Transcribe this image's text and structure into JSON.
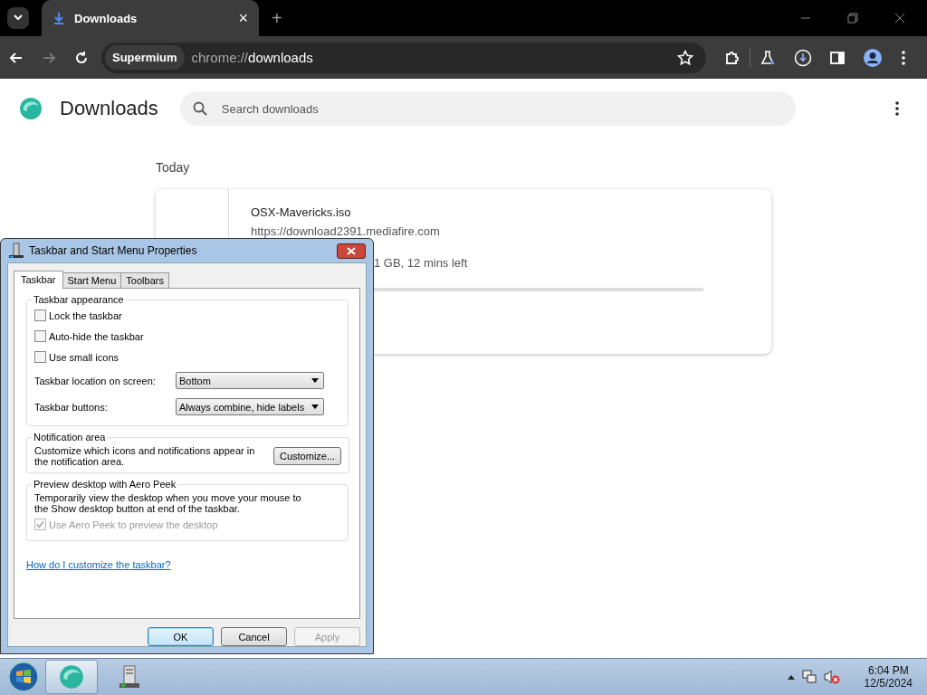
{
  "browser": {
    "tab": {
      "title": "Downloads",
      "close": "×"
    },
    "new_tab": "+",
    "address": {
      "chip": "Supermium",
      "scheme": "chrome://",
      "path": "downloads"
    }
  },
  "page": {
    "title": "Downloads",
    "search": {
      "placeholder": "Search downloads"
    },
    "section": "Today",
    "download": {
      "filename": "OSX-Mavericks.iso",
      "url": "https://download2391.mediafire.com",
      "status": "1 GB, 12 mins left"
    }
  },
  "dialog": {
    "title": "Taskbar and Start Menu Properties",
    "tabs": [
      {
        "label": "Taskbar",
        "selected": true
      },
      {
        "label": "Start Menu",
        "selected": false
      },
      {
        "label": "Toolbars",
        "selected": false
      }
    ],
    "appearance": {
      "legend": "Taskbar appearance",
      "options": [
        {
          "label": "Lock the taskbar",
          "checked": false,
          "disabled": false
        },
        {
          "label": "Auto-hide the taskbar",
          "checked": false,
          "disabled": false
        },
        {
          "label": "Use small icons",
          "checked": false,
          "disabled": false
        }
      ],
      "selects": [
        {
          "label": "Taskbar location on screen:",
          "value": "Bottom"
        },
        {
          "label": "Taskbar buttons:",
          "value": "Always combine, hide labels"
        }
      ]
    },
    "notification": {
      "legend": "Notification area",
      "text": "Customize which icons and notifications appear in the notification area.",
      "button": "Customize..."
    },
    "peek": {
      "legend": "Preview desktop with Aero Peek",
      "text": "Temporarily view the desktop when you move your mouse to the Show desktop button at end of the taskbar.",
      "option": {
        "label": "Use Aero Peek to preview the desktop",
        "checked": true,
        "disabled": true
      }
    },
    "help_link": "How do I customize the taskbar?",
    "buttons": [
      {
        "label": "OK",
        "default": true,
        "disabled": false
      },
      {
        "label": "Cancel",
        "default": false,
        "disabled": false
      },
      {
        "label": "Apply",
        "default": false,
        "disabled": true
      }
    ]
  },
  "taskbar": {
    "apps": [
      {
        "kind": "browser",
        "active": true
      },
      {
        "kind": "server",
        "active": false
      }
    ],
    "time": "6:04 PM",
    "date": "12/5/2024"
  }
}
